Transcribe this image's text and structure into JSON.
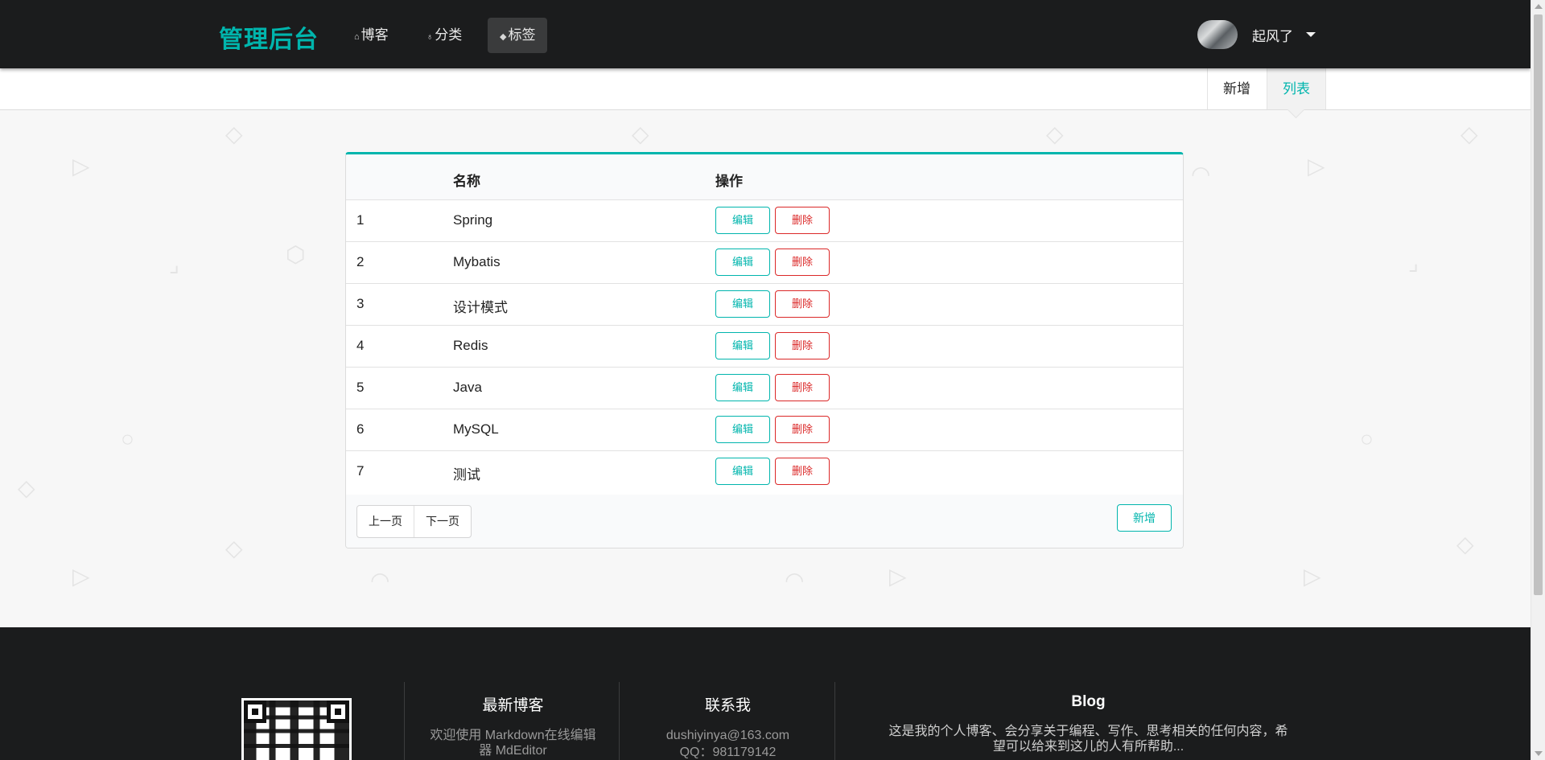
{
  "nav": {
    "brand": "管理后台",
    "items": [
      {
        "label": "博客",
        "icon": "home-icon"
      },
      {
        "label": "分类",
        "icon": "idea-icon"
      },
      {
        "label": "标签",
        "icon": "tags-icon"
      }
    ],
    "user_name": "起风了"
  },
  "subnav": {
    "add_label": "新增",
    "list_label": "列表"
  },
  "table": {
    "headers": [
      "",
      "名称",
      "操作"
    ],
    "rows": [
      {
        "id": "1",
        "name": "Spring"
      },
      {
        "id": "2",
        "name": "Mybatis"
      },
      {
        "id": "3",
        "name": "设计模式"
      },
      {
        "id": "4",
        "name": "Redis"
      },
      {
        "id": "5",
        "name": "Java"
      },
      {
        "id": "6",
        "name": "MySQL"
      },
      {
        "id": "7",
        "name": "测试"
      }
    ],
    "edit_label": "编辑",
    "delete_label": "删除",
    "prev_label": "上一页",
    "next_label": "下一页",
    "add_label": "新增"
  },
  "footer": {
    "latest_title": "最新博客",
    "latest_item_line1": "欢迎使用 Markdown在线编辑",
    "latest_item_line2": "器 MdEditor",
    "contact_title": "联系我",
    "contact_email": "dushiyinya@163.com",
    "contact_qq": "QQ：981179142",
    "blog_title": "Blog",
    "blog_line1": "这是我的个人博客、会分享关于编程、写作、思考相关的任何内容，希",
    "blog_line2": "望可以给来到这儿的人有所帮助..."
  },
  "colors": {
    "accent": "#00b5ad",
    "danger": "#db2828",
    "nav_bg": "#1b1c1d"
  }
}
